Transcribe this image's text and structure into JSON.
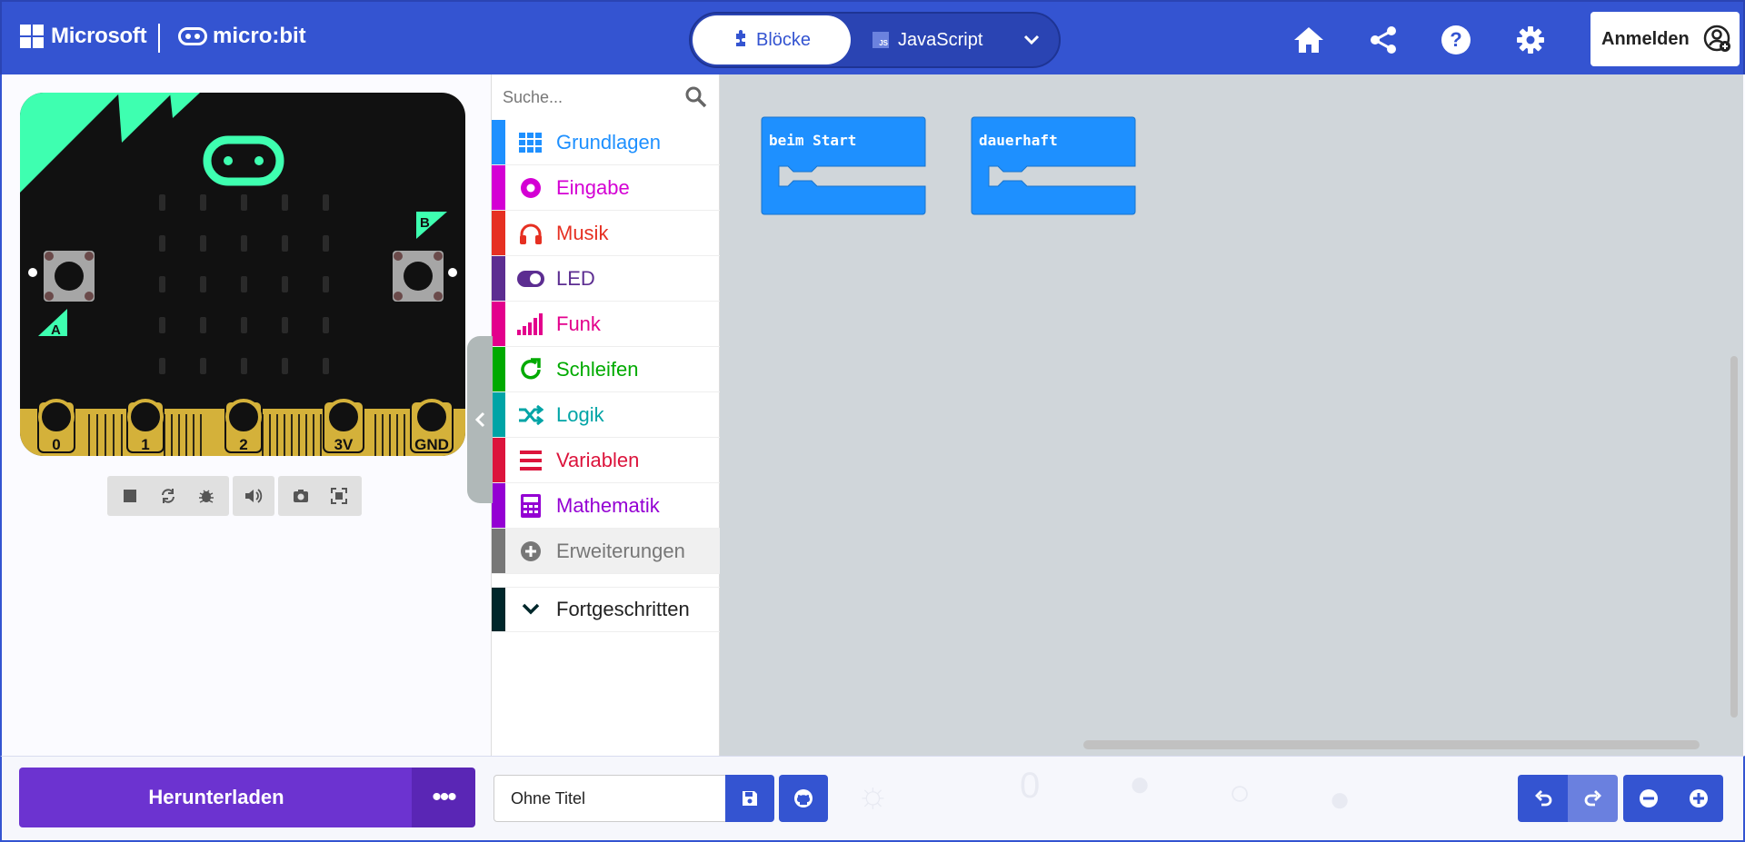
{
  "header": {
    "microsoft_label": "Microsoft",
    "microbit_label": "micro:bit",
    "tab_blocks": "Blöcke",
    "tab_javascript": "JavaScript",
    "js_badge": "JS",
    "signin_label": "Anmelden"
  },
  "simulator": {
    "pins": [
      "0",
      "1",
      "2",
      "3V",
      "GND"
    ],
    "button_a": "A",
    "button_b": "B",
    "toolbar_icons": [
      "stop-icon",
      "restart-icon",
      "debug-icon",
      "mute-icon",
      "screenshot-icon",
      "fullscreen-icon"
    ]
  },
  "toolbox": {
    "search_placeholder": "Suche...",
    "categories": [
      {
        "label": "Grundlagen",
        "color": "#1e90ff"
      },
      {
        "label": "Eingabe",
        "color": "#d400d4"
      },
      {
        "label": "Musik",
        "color": "#e63022"
      },
      {
        "label": "LED",
        "color": "#5c2d91"
      },
      {
        "label": "Funk",
        "color": "#e3008c"
      },
      {
        "label": "Schleifen",
        "color": "#00aa00"
      },
      {
        "label": "Logik",
        "color": "#00a4a6"
      },
      {
        "label": "Variablen",
        "color": "#dc143c"
      },
      {
        "label": "Mathematik",
        "color": "#9400d3"
      },
      {
        "label": "Erweiterungen",
        "color": "#777777"
      },
      {
        "label": "Fortgeschritten",
        "color": "#00272b"
      }
    ]
  },
  "workspace": {
    "blocks": [
      {
        "label": "beim Start"
      },
      {
        "label": "dauerhaft"
      }
    ],
    "block_color": "#1e90ff"
  },
  "footer": {
    "download_label": "Herunterladen",
    "more_label": "•••",
    "project_name": "Ohne Titel"
  },
  "colors": {
    "header_bg": "#3454d1",
    "download_bg": "#6c33d0",
    "workspace_bg": "#ecf0f1"
  }
}
